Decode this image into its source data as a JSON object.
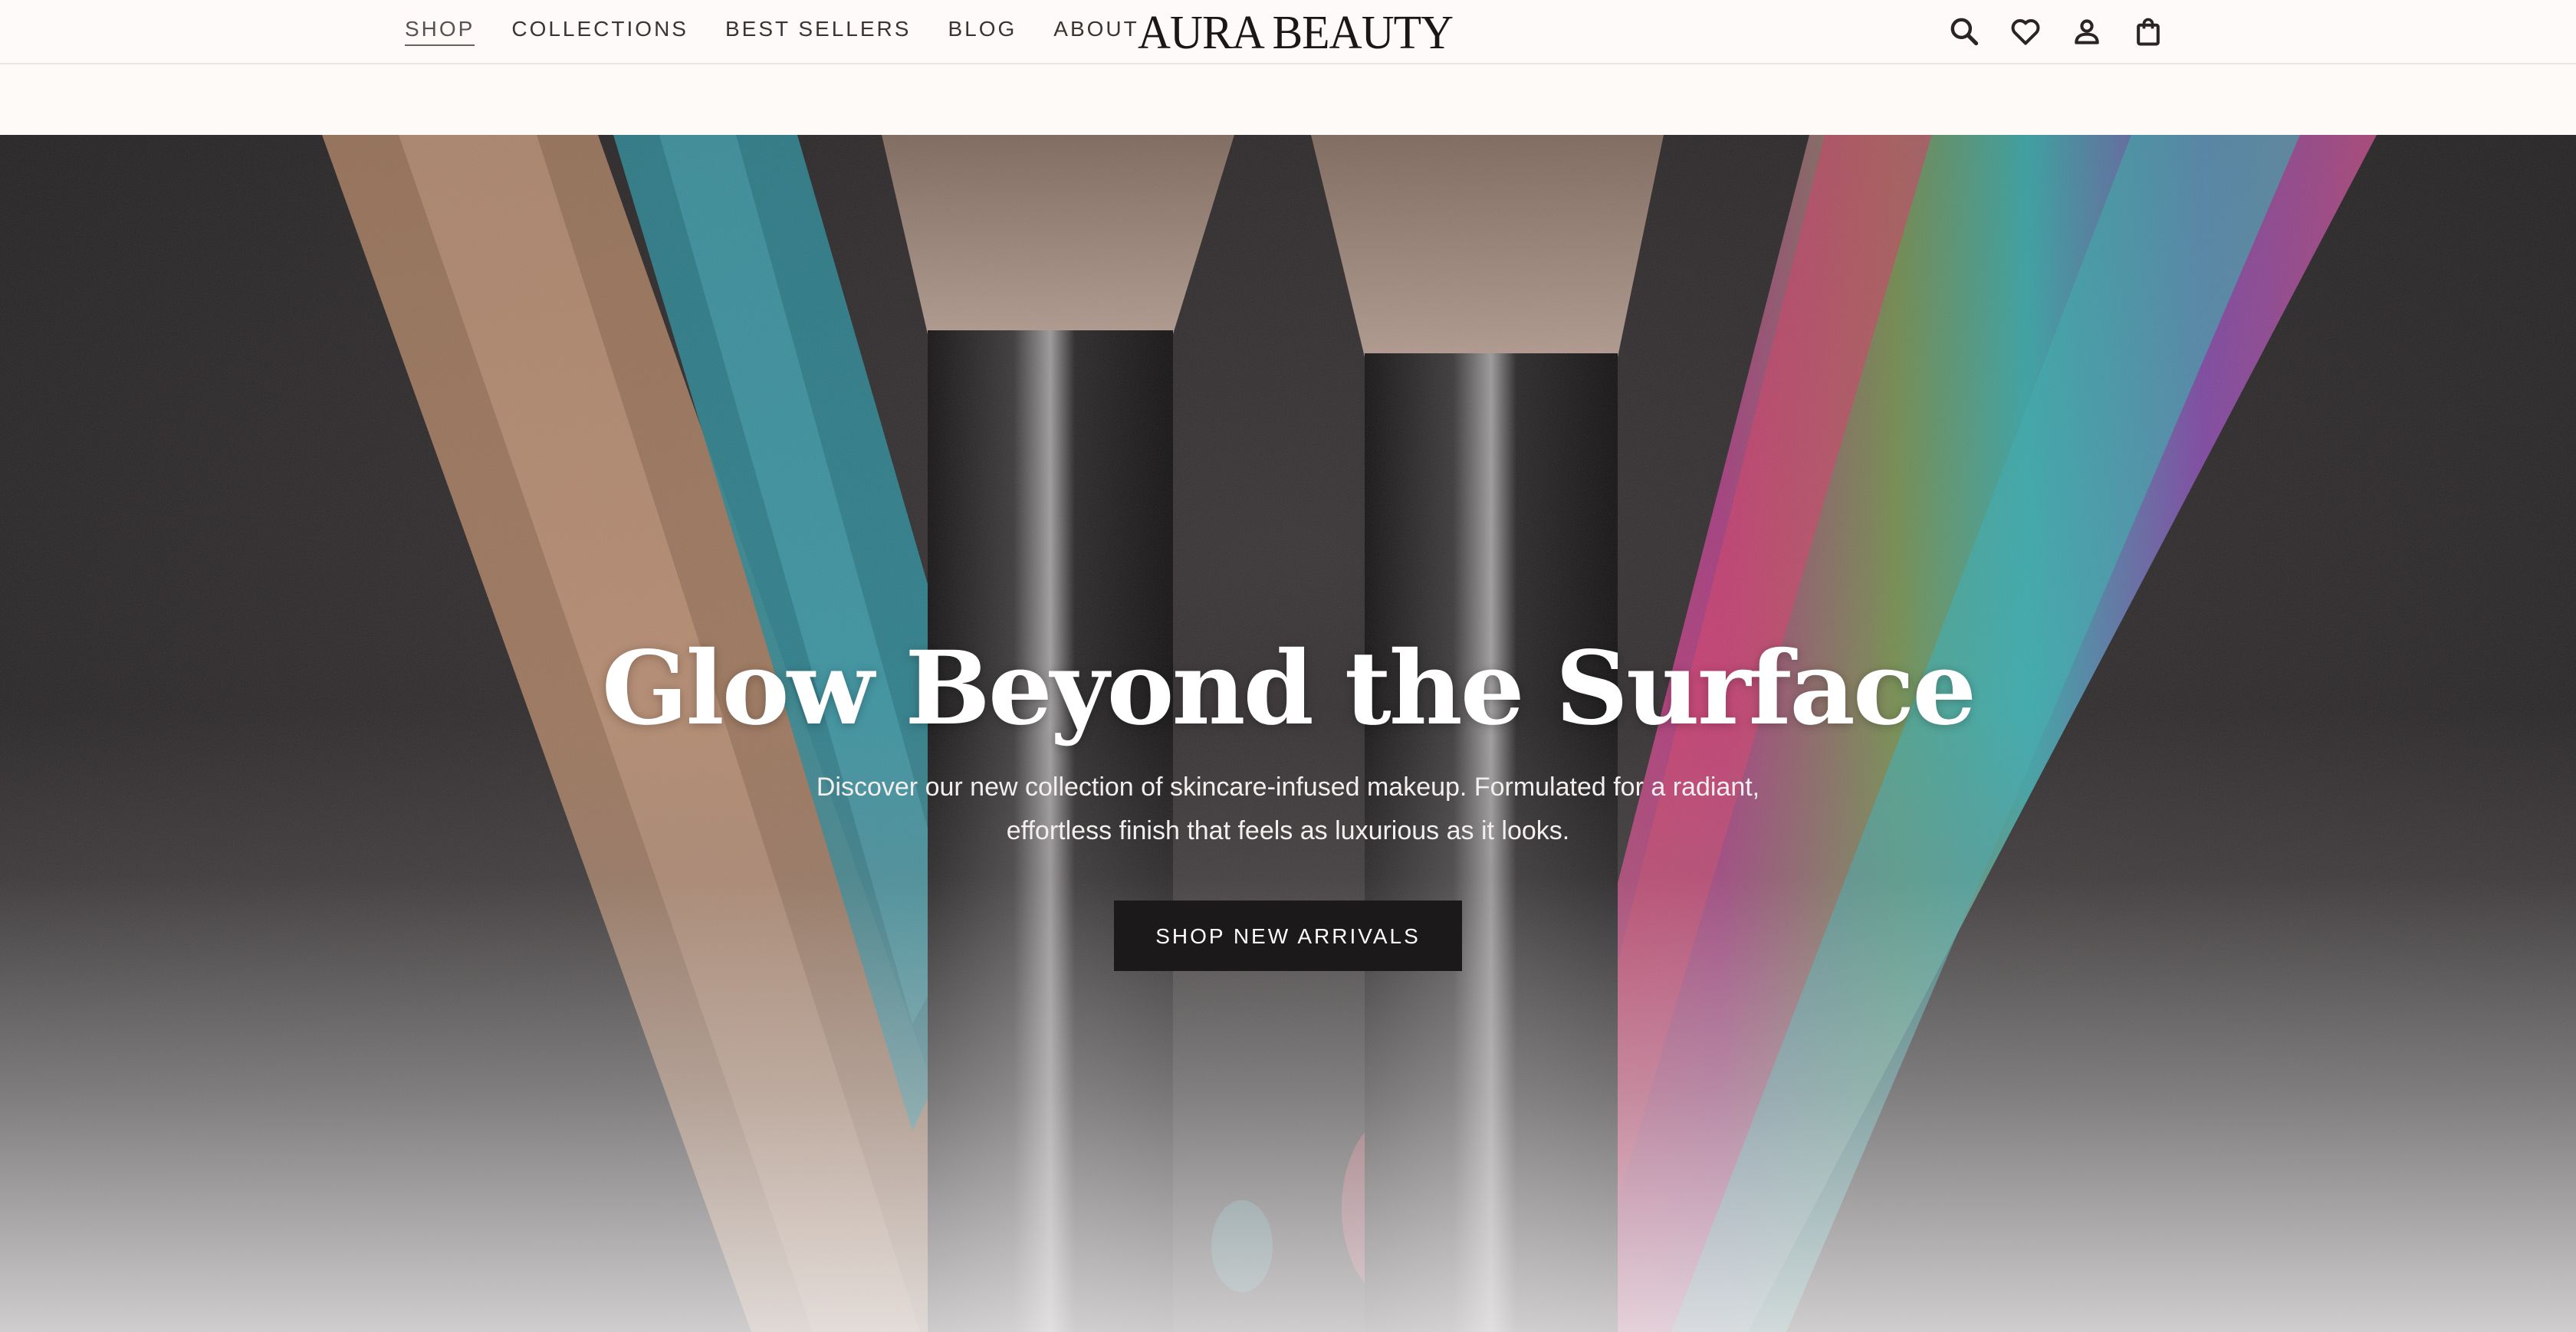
{
  "header": {
    "nav": [
      {
        "label": "SHOP",
        "active": true
      },
      {
        "label": "COLLECTIONS"
      },
      {
        "label": "BEST SELLERS"
      },
      {
        "label": "BLOG"
      },
      {
        "label": "ABOUT"
      }
    ],
    "brand": "AURA BEAUTY",
    "icons": [
      "search-icon",
      "heart-icon",
      "user-icon",
      "shopping-bag-icon"
    ]
  },
  "hero": {
    "title": "Glow Beyond the Surface",
    "subtitle": "Discover our new collection of skincare-infused makeup. Formulated for a radiant, effortless finish that feels as luxurious as it looks.",
    "cta_label": "SHOP NEW ARRIVALS"
  },
  "colors": {
    "header_bg": "#fdfaf9",
    "text_dark": "#1b1717",
    "cta_bg": "#1b1919",
    "cta_text": "#ffffff"
  }
}
